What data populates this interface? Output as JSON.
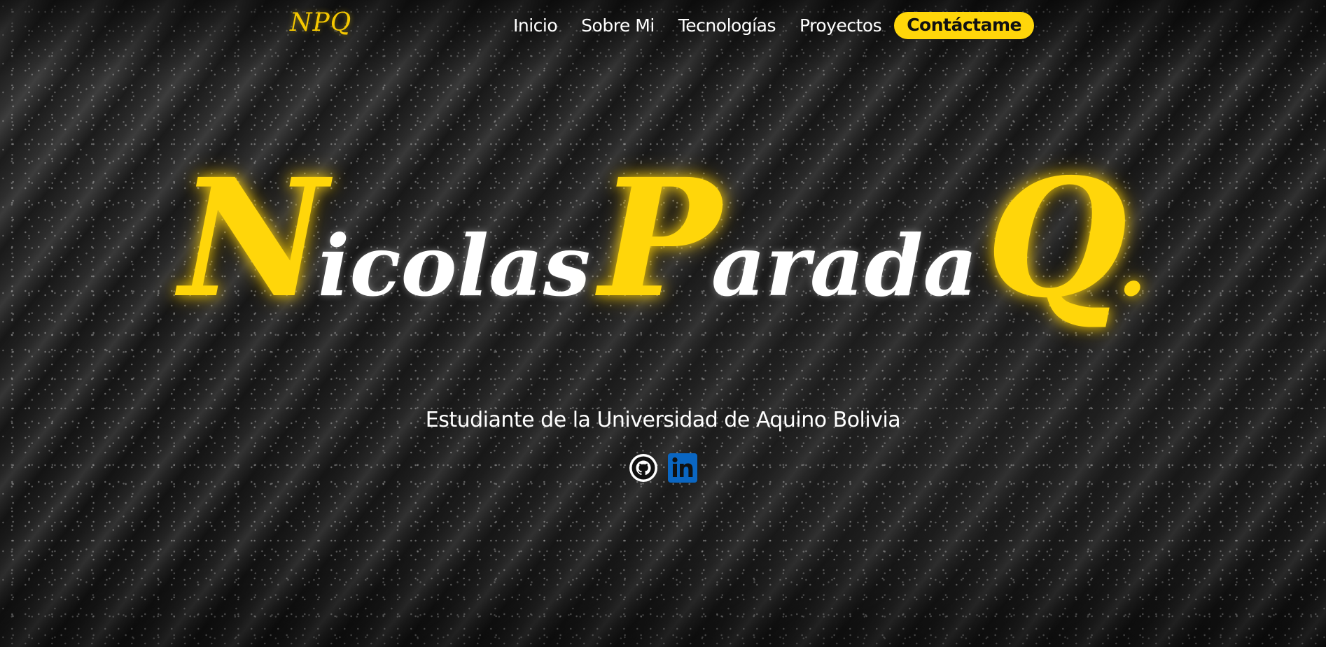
{
  "nav": {
    "logo": "NPQ",
    "links": [
      {
        "label": "Inicio"
      },
      {
        "label": "Sobre Mi"
      },
      {
        "label": "Tecnologías"
      },
      {
        "label": "Proyectos"
      }
    ],
    "cta": "Contáctame"
  },
  "hero": {
    "name": [
      {
        "initial": "N",
        "rest": "icolas"
      },
      {
        "initial": "P",
        "rest": "arada"
      },
      {
        "initial": "Q",
        "rest": "."
      }
    ],
    "subtitle": "Estudiante de la Universidad de Aquino Bolivia"
  },
  "socials": [
    {
      "icon": "github-icon"
    },
    {
      "icon": "linkedin-icon"
    }
  ],
  "colors": {
    "accent": "#ffd60a",
    "text": "#ffffff",
    "background": "#0a0a0a",
    "linkedin": "#0a66c2"
  }
}
